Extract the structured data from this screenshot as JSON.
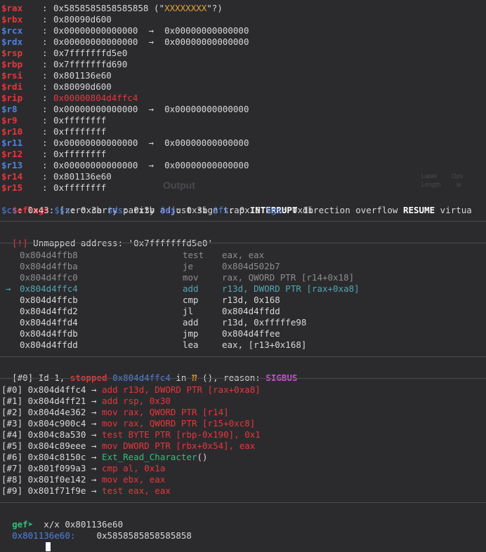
{
  "registers": [
    {
      "name": "$rax",
      "color": "red",
      "value": "0x5858585858585858",
      "extra": "(\"XXXXXXXX\"?)"
    },
    {
      "name": "$rbx",
      "color": "red",
      "value": "0x80090d600"
    },
    {
      "name": "$rcx",
      "color": "blue",
      "value": "0x00000000000000",
      "arrow": "→",
      "value2": "0x00000000000000"
    },
    {
      "name": "$rdx",
      "color": "blue",
      "value": "0x00000000000000",
      "arrow": "→",
      "value2": "0x00000000000000"
    },
    {
      "name": "$rsp",
      "color": "red",
      "value": "0x7fffffffd5e0"
    },
    {
      "name": "$rbp",
      "color": "red",
      "value": "0x7fffffffd690"
    },
    {
      "name": "$rsi",
      "color": "red",
      "value": "0x801136e60"
    },
    {
      "name": "$rdi",
      "color": "red",
      "value": "0x80090d600"
    },
    {
      "name": "$rip",
      "color": "red",
      "value": "0x00000804d4ffc4",
      "value_red": true
    },
    {
      "name": "$r8",
      "color": "blue",
      "value": "0x00000000000000",
      "arrow": "→",
      "value2": "0x00000000000000"
    },
    {
      "name": "$r9",
      "color": "red",
      "value": "0xffffffff"
    },
    {
      "name": "$r10",
      "color": "red",
      "value": "0xffffffff"
    },
    {
      "name": "$r11",
      "color": "blue",
      "value": "0x00000000000000",
      "arrow": "→",
      "value2": "0x00000000000000"
    },
    {
      "name": "$r12",
      "color": "red",
      "value": "0xffffffff"
    },
    {
      "name": "$r13",
      "color": "blue",
      "value": "0x00000000000000",
      "arrow": "→",
      "value2": "0x00000000000000"
    },
    {
      "name": "$r14",
      "color": "red",
      "value": "0x801136e60"
    },
    {
      "name": "$r15",
      "color": "red",
      "value": "0xffffffff"
    }
  ],
  "eflags": {
    "label": "$eflags",
    "pre": ": [zero carry parity adjust sign trap ",
    "bold1": "INTERRUPT",
    "mid": " direction overflow ",
    "bold2": "RESUME",
    "post": " virtua"
  },
  "segments": [
    {
      "name": "$cs",
      "value": "0x43"
    },
    {
      "name": "$ss",
      "value": "0x3b"
    },
    {
      "name": "$ds",
      "value": "0x3b"
    },
    {
      "name": "$es",
      "value": "0x3b"
    },
    {
      "name": "$fs",
      "value": "0x13"
    },
    {
      "name": "$gs",
      "value": "0x1b"
    }
  ],
  "ghost": {
    "output": "Output",
    "col_a": "Label",
    "col_b": "Ops",
    "col_c": "Length",
    "col_d": "le"
  },
  "unmapped": {
    "tag": "[!]",
    "text": " Unmapped address: '0x7fffffffd5e0'"
  },
  "disasm": [
    {
      "addr": "0x804d4ffb8",
      "mnem": "test",
      "ops": "eax, eax",
      "state": "past"
    },
    {
      "addr": "0x804d4ffba",
      "mnem": "je",
      "ops": "0x804d502b7",
      "state": "past"
    },
    {
      "addr": "0x804d4ffc0",
      "mnem": "mov",
      "ops": "rax, QWORD PTR [r14+0x18]",
      "state": "past"
    },
    {
      "addr": "0x804d4ffc4",
      "mnem": "add",
      "ops": "r13d, DWORD PTR [rax+0xa8]",
      "state": "current",
      "marker": "→"
    },
    {
      "addr": "0x804d4ffcb",
      "mnem": "cmp",
      "ops": "r13d, 0x168",
      "state": "next"
    },
    {
      "addr": "0x804d4ffd2",
      "mnem": "jl",
      "ops": "0x804d4ffdd",
      "state": "next"
    },
    {
      "addr": "0x804d4ffd4",
      "mnem": "add",
      "ops": "r13d, 0xfffffe98",
      "state": "next"
    },
    {
      "addr": "0x804d4ffdb",
      "mnem": "jmp",
      "ops": "0x804d4ffee",
      "state": "next"
    },
    {
      "addr": "0x804d4ffdd",
      "mnem": "lea",
      "ops": "eax, [r13+0x168]",
      "state": "next"
    }
  ],
  "thread": {
    "tag": "[#0]",
    "id": " Id 1, ",
    "stopped": "stopped",
    "addr": "0x804d4ffc4",
    "in": " in ",
    "func": "⁇",
    "rest": " (), reason: ",
    "reason": "SIGBUS"
  },
  "backtrace": [
    {
      "frame": "[#0]",
      "addr": "0x804d4ffc4",
      "arrow": "→",
      "instr": "add r13d, DWORD PTR [rax+0xa8]",
      "kind": "instr"
    },
    {
      "frame": "[#1]",
      "addr": "0x804d4ff21",
      "arrow": "→",
      "instr": "add rsp, 0x30",
      "kind": "instr"
    },
    {
      "frame": "[#2]",
      "addr": "0x804d4e362",
      "arrow": "→",
      "instr": "mov rax, QWORD PTR [r14]",
      "kind": "instr"
    },
    {
      "frame": "[#3]",
      "addr": "0x804c900c4",
      "arrow": "→",
      "instr": "mov rax, QWORD PTR [r15+0xc8]",
      "kind": "instr"
    },
    {
      "frame": "[#4]",
      "addr": "0x804c8a530",
      "arrow": "→",
      "instr": "test BYTE PTR [rbp-0x190], 0x1",
      "kind": "instr"
    },
    {
      "frame": "[#5]",
      "addr": "0x804c89eee",
      "arrow": "→",
      "instr": "mov DWORD PTR [rbx+0x54], eax",
      "kind": "instr"
    },
    {
      "frame": "[#6]",
      "addr": "0x804c8150c",
      "arrow": "→",
      "instr": "Ext_Read_Character",
      "suffix": "()",
      "kind": "func"
    },
    {
      "frame": "[#7]",
      "addr": "0x801f099a3",
      "arrow": "→",
      "instr": "cmp al, 0x1a",
      "kind": "instr"
    },
    {
      "frame": "[#8]",
      "addr": "0x801f0e142",
      "arrow": "→",
      "instr": "mov ebx, eax",
      "kind": "instr"
    },
    {
      "frame": "[#9]",
      "addr": "0x801f71f9e",
      "arrow": "→",
      "instr": "test eax, eax",
      "kind": "instr"
    }
  ],
  "prompt": {
    "label": "gef➤",
    "command": "  x/x 0x801136e60"
  },
  "memdump": {
    "addr": "0x801136e60:",
    "value": "0x5858585858585858"
  },
  "colors": {
    "background": "#2b2b2e",
    "reg_red": "#e8363a",
    "reg_blue": "#4f82e0",
    "cyan": "#50a7b2",
    "green": "#2fc178",
    "magenta": "#c94fd0",
    "yellow": "#e5a13a",
    "dim": "#8d8d8d"
  }
}
